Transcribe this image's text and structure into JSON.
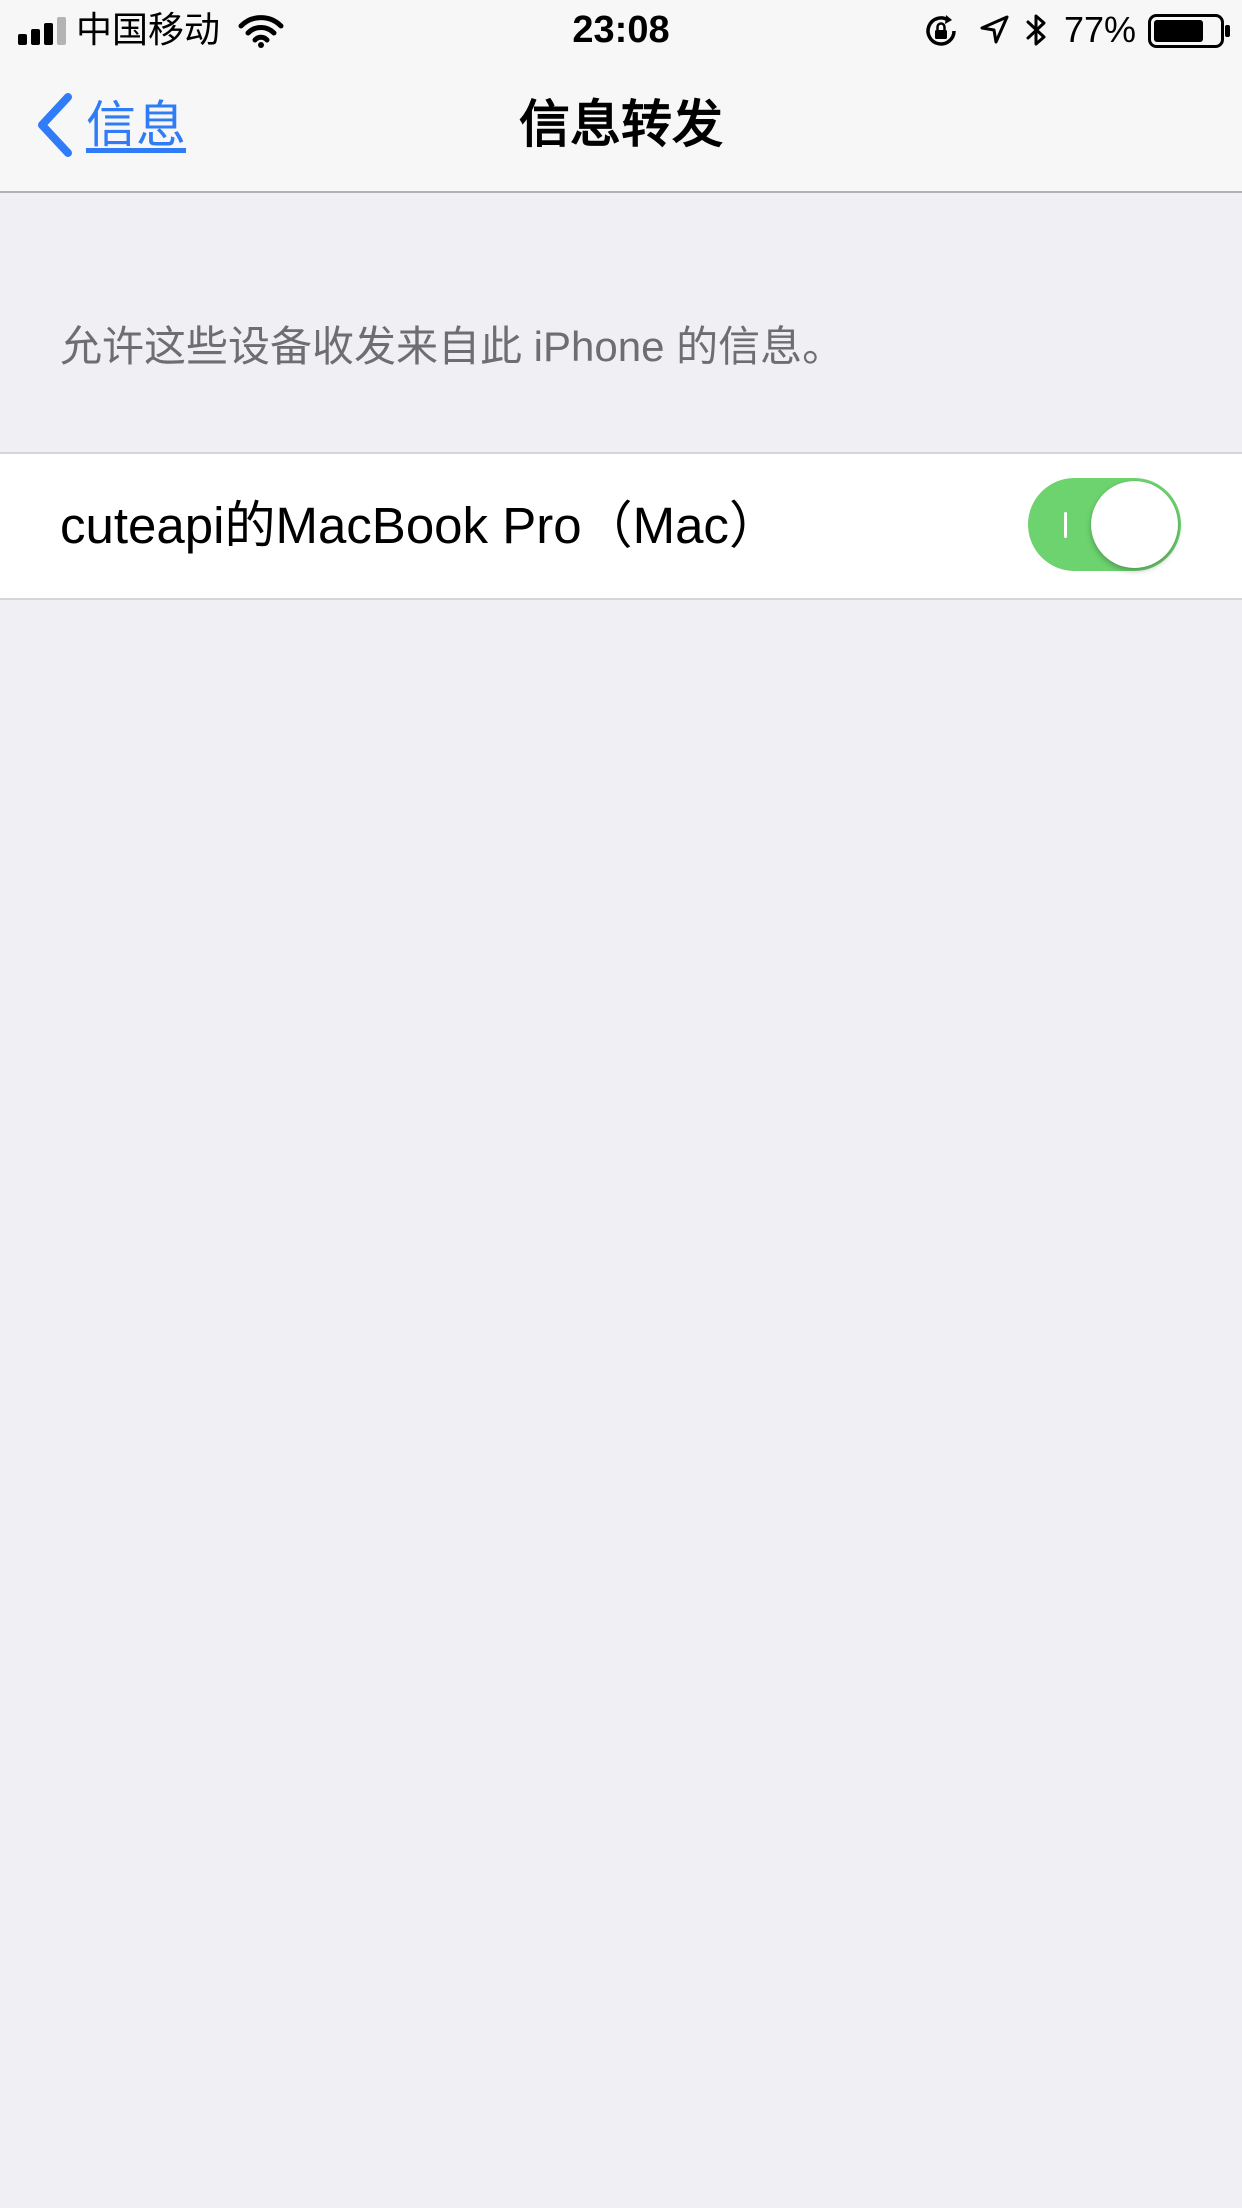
{
  "status_bar": {
    "carrier": "中国移动",
    "time": "23:08",
    "battery_percent": "77%",
    "signal_bars_filled": 3,
    "signal_bars_total": 4,
    "battery_level": 0.77,
    "icons": [
      "signal-icon",
      "wifi-icon",
      "rotation-lock-icon",
      "location-icon",
      "bluetooth-icon",
      "battery-icon"
    ]
  },
  "nav": {
    "back_label": "信息",
    "title": "信息转发"
  },
  "content": {
    "description": "允许这些设备收发来自此 iPhone 的信息。",
    "devices": [
      {
        "name": "cuteapi的MacBook Pro（Mac）",
        "enabled": true
      }
    ]
  },
  "colors": {
    "accent": "#2F7CF6",
    "toggle_on": "#6CD36E",
    "background": "#EFEFF4",
    "secondary_text": "#6D6D72"
  }
}
